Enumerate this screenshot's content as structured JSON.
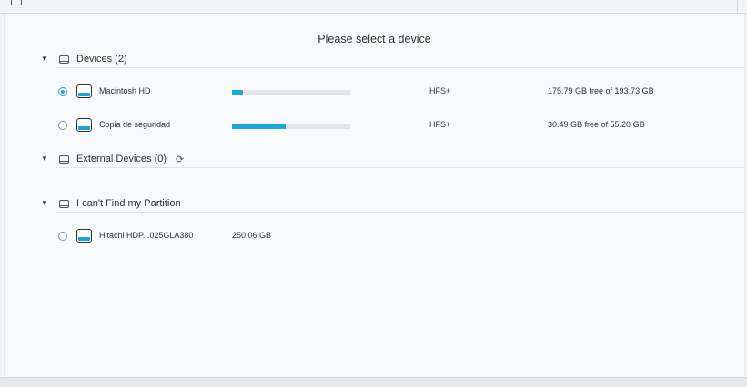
{
  "window": {
    "title": ""
  },
  "heading": "Please select a device",
  "sections": [
    {
      "label": "Devices (2)",
      "items": [
        {
          "name": "Macintosh HD",
          "usage": 0.09,
          "fs": "HFS+",
          "free": "175.79 GB free of 193.73 GB",
          "selected": true
        },
        {
          "name": "Copia de seguridad",
          "usage": 0.45,
          "fs": "HFS+",
          "free": "30.49 GB free of 55.20 GB",
          "selected": false
        }
      ]
    },
    {
      "label": "External Devices (0)",
      "items": []
    },
    {
      "label": "I can't Find my Partition",
      "items": [
        {
          "name": "Hitachi HDP...025GLA380",
          "size": "250.06 GB",
          "selected": false
        }
      ]
    }
  ],
  "colors": {
    "accent": "#1ba3dc",
    "background": "#f7f9fa"
  },
  "icons": {
    "disk": "hard-drive-icon",
    "section": "drive-icon",
    "refresh": "refresh-icon",
    "collapse": "chevron-down-icon"
  }
}
